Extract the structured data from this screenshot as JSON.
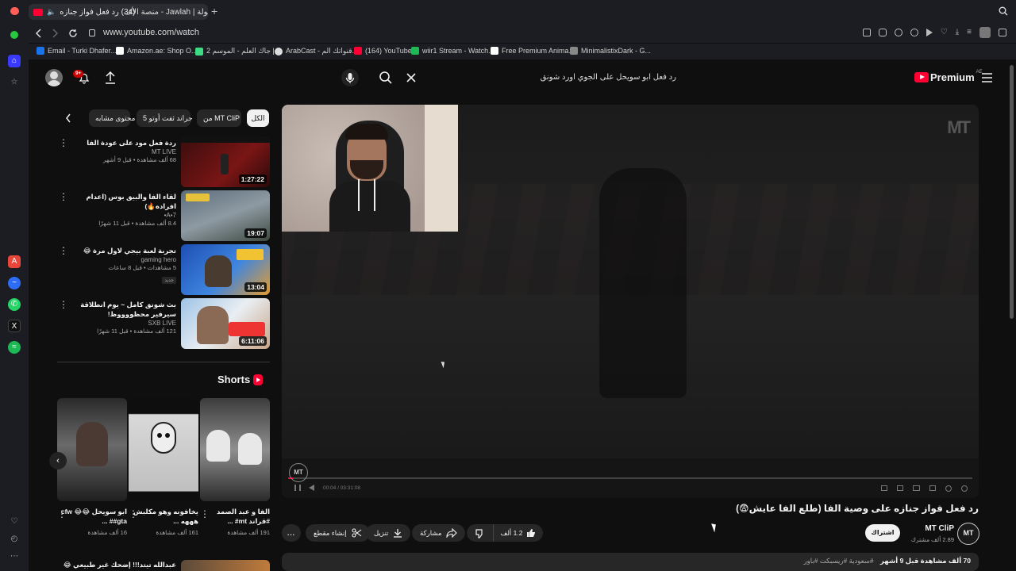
{
  "browser": {
    "tab_title": "(34) رد فعل فواز جنازه",
    "tab_title_2": "جولة | Jawlah - منصة الأف",
    "tab_title_3": "موجه",
    "url": "www.youtube.com/watch",
    "bookmarks": [
      {
        "label": "Email - Turki Dhafer...",
        "color": "#1a73e8"
      },
      {
        "label": "Amazon.ae: Shop O...",
        "color": "#ffffff"
      },
      {
        "label": "جاك العلم - الموسم 2 |...",
        "color": "#3ddc84"
      },
      {
        "label": "ArabCast - قنواتك الم...",
        "color": "#dddddd"
      },
      {
        "label": "(164) YouTube",
        "color": "#ff0033"
      },
      {
        "label": "wiir1 Stream - Watch...",
        "color": "#1db954"
      },
      {
        "label": "Free Premium Anima...",
        "color": "#ffffff"
      },
      {
        "label": "MinimalistixDark - G...",
        "color": "#888888"
      }
    ]
  },
  "youtube": {
    "notifications_badge": "9+",
    "search_query": "رد فعل ابو سويحل على الجوي اورد شونق",
    "premium_label": "Premium",
    "premium_region": "AE",
    "chips": [
      {
        "label": "الكل",
        "active": true
      },
      {
        "label": "من MT CliP",
        "active": false
      },
      {
        "label": "جراند ثفت أوتو 5",
        "active": false
      },
      {
        "label": "محتوى مشابه",
        "active": false
      }
    ],
    "recommendations": [
      {
        "title": "ردة فعل مود على عودة الفا",
        "channel": "MT LIVE",
        "meta": "68 ألف مشاهدة • قبل 9 أشهر",
        "duration": "1:27:22",
        "badge": ""
      },
      {
        "title": "لقاء الفا والبيق بوس (اعدام افراده🔥)",
        "channel": "A•7•",
        "meta": "8.4 ألف مشاهدة • قبل 11 شهرًا",
        "duration": "19:07",
        "badge": ""
      },
      {
        "title": "تجربة لعبة بيجي لاول مرة 😂",
        "channel": "gaming hero",
        "meta": "5 مشاهدات • قبل 8 ساعات",
        "duration": "13:04",
        "badge": "جديد"
      },
      {
        "title": "بث شونق كامل ~ يوم انطلاقة سيرفير محظووووظ!",
        "channel": "SXB LIVE",
        "meta": "121 ألف مشاهدة • قبل 11 شهرًا",
        "duration": "6:11:06",
        "badge": ""
      }
    ],
    "shorts_heading": "Shorts",
    "shorts": [
      {
        "title": "الفا و عبد الصمد #قراند mt# ...",
        "views": "191 ألف مشاهدة"
      },
      {
        "title": "يخافونه وهو مكلبش هههه ...",
        "views": "161 ألف مشاهدة"
      },
      {
        "title": "ابو سويحل 😂😂 cfw #gta# ...",
        "views": "16 ألف مشاهدة"
      }
    ],
    "bottom_item": "عبدالله تيتد!!! إضحك غير طبيعي 😂",
    "player": {
      "watermark": "MT",
      "time": "00:04 / 03:31:08",
      "channel_logo": "MT"
    },
    "video": {
      "title": "رد فعل فواز جنازه على وصية الفا (طلع الفا عايش😨)",
      "channel_name": "MT CliP",
      "subscribers": "2.89 ألف مشترك",
      "subscribe_label": "اشتراك",
      "likes": "1.2 ألف",
      "share_label": "مشاركة",
      "download_label": "تنزيل",
      "clip_label": "إنشاء مقطع",
      "more_label": "...",
      "views_line": "70 ألف مشاهدة قبل 9 أشهر",
      "hashtags": "#سعودية #ريسبكت #باور"
    }
  },
  "colors": {
    "youtube_red": "#ff0033",
    "bg": "#0f0f0f",
    "chip_bg": "#272727"
  }
}
